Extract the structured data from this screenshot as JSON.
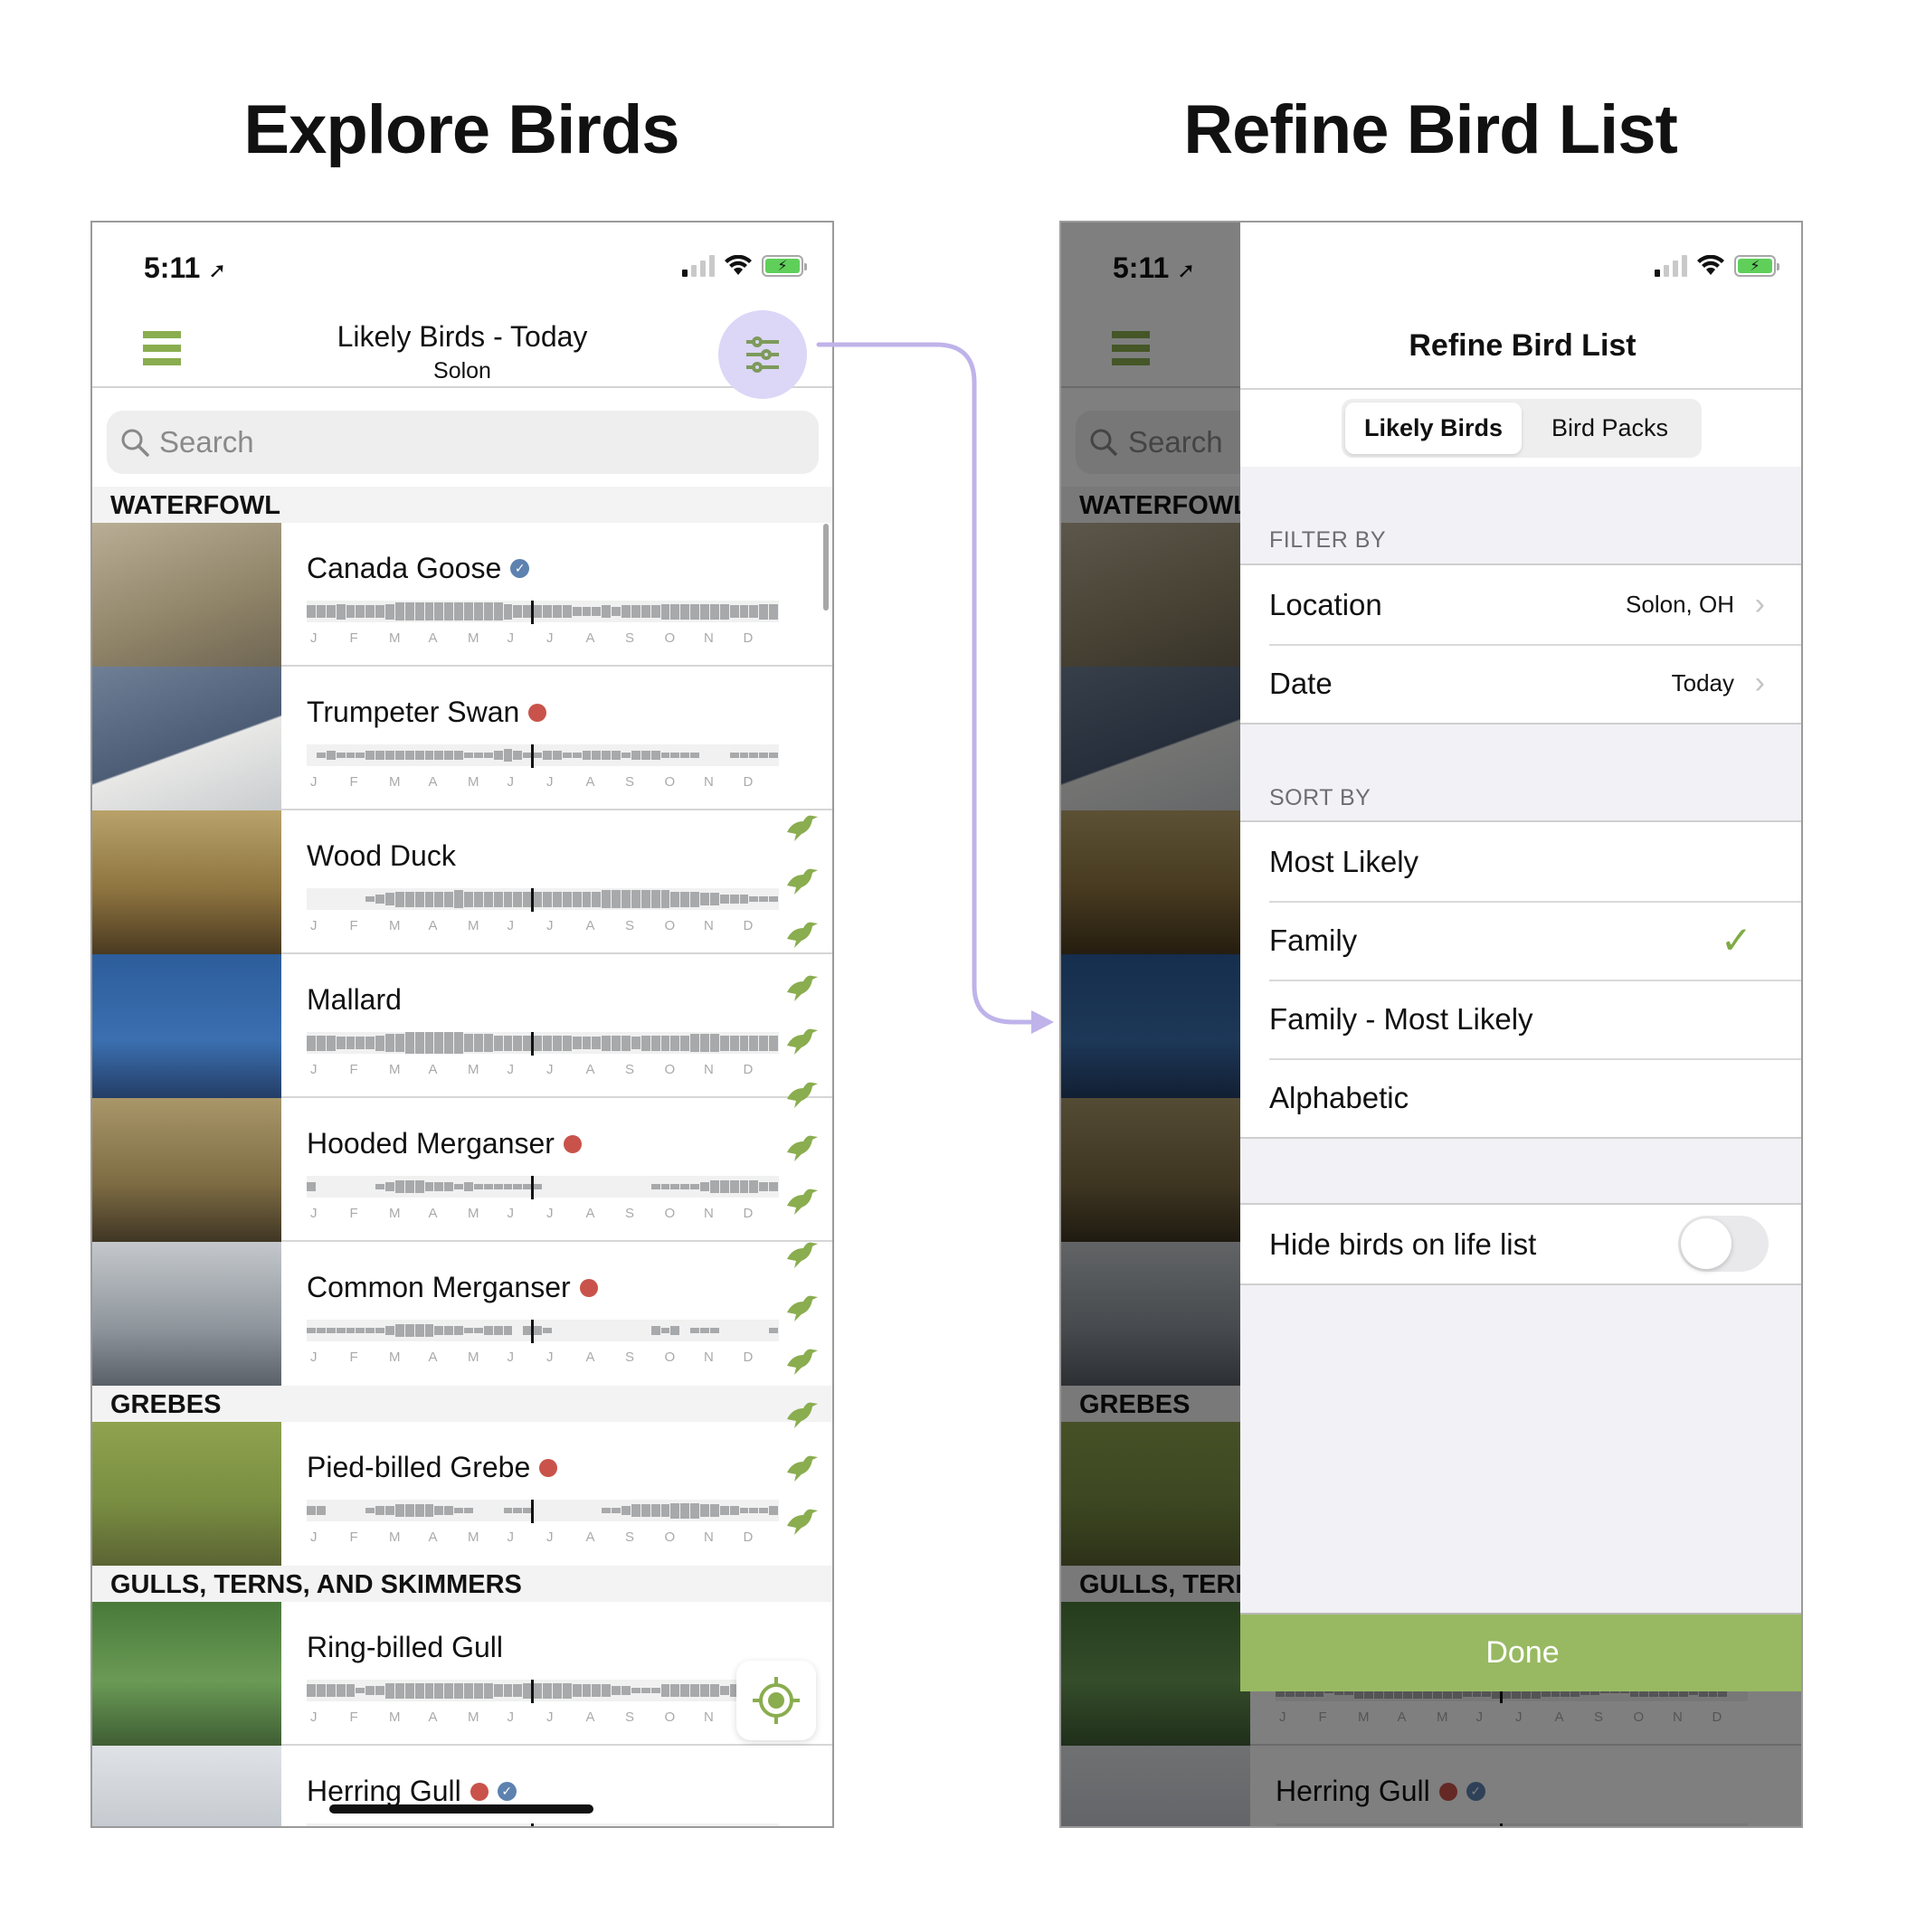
{
  "titles": {
    "left": "Explore Birds",
    "right": "Refine Bird List"
  },
  "colors": {
    "accent_green": "#8aad4f",
    "done_green": "#98b962",
    "highlight_purple": "#dcd6f7",
    "connector_purple": "#bfb3ea",
    "rare_red": "#c9534a",
    "life_list_blue": "#5d82b0"
  },
  "status_bar": {
    "time": "5:11",
    "location_icon": "location-arrow-icon",
    "signal_icon": "cellular-signal-icon",
    "wifi_icon": "wifi-icon",
    "battery_icon": "battery-charging-icon"
  },
  "explore": {
    "nav": {
      "title": "Likely Birds - Today",
      "subtitle": "Solon",
      "menu_icon": "hamburger-menu-icon",
      "filter_icon": "sliders-icon"
    },
    "search": {
      "placeholder": "Search",
      "value": ""
    },
    "months": [
      "J",
      "F",
      "M",
      "A",
      "M",
      "J",
      "J",
      "A",
      "S",
      "O",
      "N",
      "D"
    ],
    "sections": [
      {
        "name": "WATERFOWL",
        "birds": [
          {
            "name": "Canada Goose",
            "rare": false,
            "on_life_list": true,
            "freq": [
              3,
              3,
              3,
              4,
              3,
              3,
              3,
              3,
              4,
              5,
              5,
              5,
              5,
              5,
              5,
              5,
              5,
              5,
              5,
              5,
              4,
              3,
              3,
              3,
              3,
              3,
              3,
              2,
              2,
              2,
              3,
              2,
              3,
              3,
              3,
              3,
              4,
              4,
              4,
              4,
              4,
              4,
              4,
              3,
              3,
              3,
              4,
              4
            ]
          },
          {
            "name": "Trumpeter Swan",
            "rare": true,
            "on_life_list": false,
            "freq": [
              0,
              1,
              2,
              1,
              1,
              1,
              2,
              2,
              2,
              2,
              2,
              2,
              2,
              2,
              2,
              2,
              1,
              1,
              1,
              2,
              3,
              2,
              1,
              1,
              2,
              2,
              1,
              1,
              2,
              2,
              2,
              2,
              1,
              2,
              2,
              2,
              1,
              1,
              1,
              1,
              0,
              0,
              0,
              1,
              1,
              1,
              1,
              1
            ]
          },
          {
            "name": "Wood Duck",
            "rare": false,
            "on_life_list": false,
            "freq": [
              0,
              0,
              0,
              0,
              0,
              0,
              1,
              2,
              3,
              4,
              4,
              4,
              4,
              4,
              4,
              5,
              4,
              4,
              4,
              4,
              4,
              4,
              4,
              4,
              4,
              4,
              4,
              4,
              4,
              4,
              5,
              5,
              5,
              5,
              5,
              5,
              5,
              4,
              4,
              4,
              3,
              3,
              2,
              2,
              2,
              1,
              1,
              1
            ]
          },
          {
            "name": "Mallard",
            "rare": false,
            "on_life_list": false,
            "freq": [
              4,
              4,
              4,
              3,
              3,
              3,
              3,
              4,
              5,
              5,
              6,
              6,
              6,
              6,
              6,
              6,
              5,
              5,
              5,
              4,
              4,
              4,
              4,
              4,
              4,
              4,
              4,
              3,
              3,
              3,
              4,
              4,
              4,
              3,
              4,
              4,
              4,
              4,
              4,
              5,
              5,
              5,
              4,
              4,
              4,
              4,
              4,
              4
            ]
          },
          {
            "name": "Hooded Merganser",
            "rare": true,
            "on_life_list": false,
            "freq": [
              2,
              0,
              0,
              0,
              0,
              0,
              0,
              1,
              2,
              3,
              3,
              3,
              2,
              2,
              2,
              1,
              2,
              1,
              1,
              1,
              1,
              1,
              1,
              1,
              0,
              0,
              0,
              0,
              0,
              0,
              0,
              0,
              0,
              0,
              0,
              1,
              1,
              1,
              1,
              1,
              2,
              3,
              3,
              3,
              3,
              3,
              2,
              2
            ]
          },
          {
            "name": "Common Merganser",
            "rare": true,
            "on_life_list": false,
            "freq": [
              1,
              1,
              1,
              1,
              1,
              1,
              1,
              1,
              2,
              3,
              3,
              3,
              3,
              2,
              2,
              2,
              1,
              1,
              2,
              2,
              2,
              0,
              2,
              2,
              1,
              0,
              0,
              0,
              0,
              0,
              0,
              0,
              0,
              0,
              0,
              2,
              1,
              2,
              0,
              1,
              1,
              1,
              0,
              0,
              0,
              0,
              0,
              1
            ]
          }
        ]
      },
      {
        "name": "GREBES",
        "birds": [
          {
            "name": "Pied-billed Grebe",
            "rare": true,
            "on_life_list": false,
            "freq": [
              2,
              2,
              0,
              0,
              0,
              0,
              1,
              2,
              2,
              3,
              3,
              3,
              3,
              2,
              2,
              1,
              1,
              0,
              0,
              0,
              1,
              1,
              1,
              0,
              0,
              0,
              0,
              0,
              0,
              0,
              1,
              1,
              2,
              3,
              3,
              3,
              3,
              4,
              4,
              4,
              3,
              3,
              2,
              2,
              1,
              1,
              1,
              2
            ]
          }
        ]
      },
      {
        "name": "GULLS, TERNS, AND SKIMMERS",
        "birds": [
          {
            "name": "Ring-billed Gull",
            "rare": false,
            "on_life_list": false,
            "freq": [
              3,
              3,
              3,
              3,
              3,
              1,
              2,
              2,
              4,
              4,
              4,
              4,
              4,
              4,
              4,
              4,
              4,
              4,
              4,
              3,
              3,
              3,
              4,
              4,
              4,
              4,
              4,
              3,
              3,
              3,
              3,
              2,
              2,
              1,
              1,
              1,
              3,
              3,
              3,
              3,
              3,
              3,
              2,
              3,
              3,
              3,
              0,
              0
            ]
          },
          {
            "name": "Herring Gull",
            "rare": true,
            "on_life_list": true,
            "freq": []
          }
        ]
      }
    ],
    "family_icons": [
      "duck-silhouette-icon",
      "shorebird-silhouette-icon",
      "heron-silhouette-icon",
      "dove-silhouette-icon",
      "raptor-silhouette-icon",
      "hummingbird-silhouette-icon",
      "swallow-silhouette-icon",
      "corvid-silhouette-icon",
      "thrush-silhouette-icon",
      "wren-silhouette-icon",
      "perching-bird-silhouette-icon",
      "sparrow-silhouette-icon",
      "finch-silhouette-icon",
      "warbler-silhouette-icon"
    ],
    "locate_icon": "locate-crosshair-icon"
  },
  "refine": {
    "title": "Refine Bird List",
    "segments": [
      {
        "label": "Likely Birds",
        "active": true
      },
      {
        "label": "Bird Packs",
        "active": false
      }
    ],
    "filter_by": {
      "label": "FILTER BY",
      "items": [
        {
          "label": "Location",
          "value": "Solon, OH"
        },
        {
          "label": "Date",
          "value": "Today"
        }
      ]
    },
    "sort_by": {
      "label": "SORT BY",
      "options": [
        {
          "label": "Most Likely",
          "selected": false
        },
        {
          "label": "Family",
          "selected": true
        },
        {
          "label": "Family - Most Likely",
          "selected": false
        },
        {
          "label": "Alphabetic",
          "selected": false
        }
      ]
    },
    "hide_life_list": {
      "label": "Hide birds on life list",
      "enabled": false
    },
    "done_label": "Done",
    "background_search_placeholder": "Search"
  }
}
